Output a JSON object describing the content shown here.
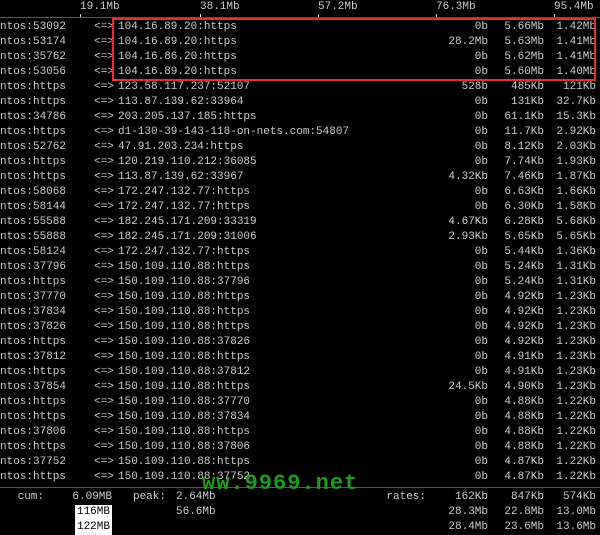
{
  "scale": [
    {
      "pos": 80,
      "label": "19.1Mb"
    },
    {
      "pos": 200,
      "label": "38.1Mb"
    },
    {
      "pos": 318,
      "label": "57.2Mb"
    },
    {
      "pos": 436,
      "label": "76.3Mb"
    },
    {
      "pos": 554,
      "label": "95.4Mb"
    }
  ],
  "arrow": "<=>",
  "rows": [
    {
      "left": "ntos:53092",
      "remote": "104.16.89.20:https",
      "v1": "0b",
      "v2": "5.66Mb",
      "v3": "1.42Mb"
    },
    {
      "left": "ntos:53174",
      "remote": "104.16.89.20:https",
      "v1": "28.2Mb",
      "v2": "5.63Mb",
      "v3": "1.41Mb"
    },
    {
      "left": "ntos:35762",
      "remote": "104.16.86.20:https",
      "v1": "0b",
      "v2": "5.62Mb",
      "v3": "1.41Mb"
    },
    {
      "left": "ntos:53056",
      "remote": "104.16.89.20:https",
      "v1": "0b",
      "v2": "5.60Mb",
      "v3": "1.40Mb"
    },
    {
      "left": "ntos:https",
      "remote": "123.58.117.237:52107",
      "v1": "528b",
      "v2": "485Kb",
      "v3": "121Kb"
    },
    {
      "left": "ntos:https",
      "remote": "113.87.139.62:33964",
      "v1": "0b",
      "v2": "131Kb",
      "v3": "32.7Kb"
    },
    {
      "left": "ntos:34786",
      "remote": "203.205.137.185:https",
      "v1": "0b",
      "v2": "61.1Kb",
      "v3": "15.3Kb"
    },
    {
      "left": "ntos:https",
      "remote": "d1-130-39-143-118-on-nets.com:54807",
      "v1": "0b",
      "v2": "11.7Kb",
      "v3": "2.92Kb"
    },
    {
      "left": "ntos:52762",
      "remote": "47.91.203.234:https",
      "v1": "0b",
      "v2": "8.12Kb",
      "v3": "2.03Kb"
    },
    {
      "left": "ntos:https",
      "remote": "120.219.110.212:36085",
      "v1": "0b",
      "v2": "7.74Kb",
      "v3": "1.93Kb"
    },
    {
      "left": "ntos:https",
      "remote": "113.87.139.62:33967",
      "v1": "4.32Kb",
      "v2": "7.46Kb",
      "v3": "1.87Kb"
    },
    {
      "left": "ntos:58068",
      "remote": "172.247.132.77:https",
      "v1": "0b",
      "v2": "6.63Kb",
      "v3": "1.66Kb"
    },
    {
      "left": "ntos:58144",
      "remote": "172.247.132.77:https",
      "v1": "0b",
      "v2": "6.30Kb",
      "v3": "1.58Kb"
    },
    {
      "left": "ntos:55588",
      "remote": "182.245.171.209:33319",
      "v1": "4.67Kb",
      "v2": "6.28Kb",
      "v3": "5.68Kb"
    },
    {
      "left": "ntos:55888",
      "remote": "182.245.171.209:31006",
      "v1": "2.93Kb",
      "v2": "5.65Kb",
      "v3": "5.65Kb"
    },
    {
      "left": "ntos:58124",
      "remote": "172.247.132.77:https",
      "v1": "0b",
      "v2": "5.44Kb",
      "v3": "1.36Kb"
    },
    {
      "left": "ntos:37796",
      "remote": "150.109.110.88:https",
      "v1": "0b",
      "v2": "5.24Kb",
      "v3": "1.31Kb"
    },
    {
      "left": "ntos:https",
      "remote": "150.109.110.88:37796",
      "v1": "0b",
      "v2": "5.24Kb",
      "v3": "1.31Kb"
    },
    {
      "left": "ntos:37770",
      "remote": "150.109.110.88:https",
      "v1": "0b",
      "v2": "4.92Kb",
      "v3": "1.23Kb"
    },
    {
      "left": "ntos:37834",
      "remote": "150.109.110.88:https",
      "v1": "0b",
      "v2": "4.92Kb",
      "v3": "1.23Kb"
    },
    {
      "left": "ntos:37826",
      "remote": "150.109.110.88:https",
      "v1": "0b",
      "v2": "4.92Kb",
      "v3": "1.23Kb"
    },
    {
      "left": "ntos:https",
      "remote": "150.109.110.88:37826",
      "v1": "0b",
      "v2": "4.92Kb",
      "v3": "1.23Kb"
    },
    {
      "left": "ntos:37812",
      "remote": "150.109.110.88:https",
      "v1": "0b",
      "v2": "4.91Kb",
      "v3": "1.23Kb"
    },
    {
      "left": "ntos:https",
      "remote": "150.109.110.88:37812",
      "v1": "0b",
      "v2": "4.91Kb",
      "v3": "1.23Kb"
    },
    {
      "left": "ntos:37854",
      "remote": "150.109.110.88:https",
      "v1": "24.5Kb",
      "v2": "4.90Kb",
      "v3": "1.23Kb"
    },
    {
      "left": "ntos:https",
      "remote": "150.109.110.88:37770",
      "v1": "0b",
      "v2": "4.88Kb",
      "v3": "1.22Kb"
    },
    {
      "left": "ntos:https",
      "remote": "150.109.110.88:37834",
      "v1": "0b",
      "v2": "4.88Kb",
      "v3": "1.22Kb"
    },
    {
      "left": "ntos:37806",
      "remote": "150.109.110.88:https",
      "v1": "0b",
      "v2": "4.88Kb",
      "v3": "1.22Kb"
    },
    {
      "left": "ntos:https",
      "remote": "150.109.110.88:37806",
      "v1": "0b",
      "v2": "4.88Kb",
      "v3": "1.22Kb"
    },
    {
      "left": "ntos:37752",
      "remote": "150.109.110.88:https",
      "v1": "0b",
      "v2": "4.87Kb",
      "v3": "1.22Kb"
    },
    {
      "left": "ntos:https",
      "remote": "150.109.110.88:37752",
      "v1": "0b",
      "v2": "4.87Kb",
      "v3": "1.22Kb"
    }
  ],
  "footer": {
    "cum_label": "cum:",
    "peak_label": "peak:",
    "rates_label": "rates:",
    "lines": [
      {
        "cum": "6.09MB",
        "peak": "2.64Mb",
        "r1": "162Kb",
        "r2": "847Kb",
        "r3": "574Kb"
      },
      {
        "cum": "116MB",
        "peak": "56.6Mb",
        "r1": "28.3Mb",
        "r2": "22.8Mb",
        "r3": "13.0Mb"
      },
      {
        "cum": "122MB",
        "peak": "",
        "r1": "28.4Mb",
        "r2": "23.6Mb",
        "r3": "13.6Mb"
      }
    ]
  },
  "watermark": "ww.9969.net"
}
